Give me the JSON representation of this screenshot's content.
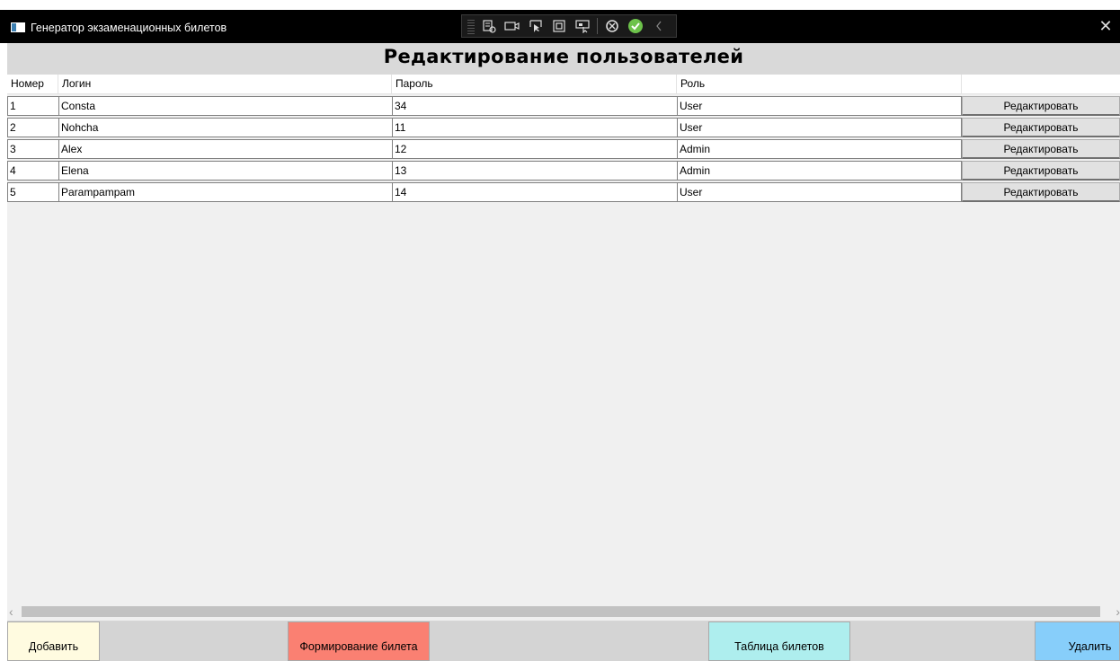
{
  "window": {
    "title": "Генератор экзаменационных билетов",
    "close_glyph": "✕"
  },
  "devtools": {
    "icons": [
      "live-visual-tree-icon",
      "video-record-icon",
      "select-element-icon",
      "display-layout-adorners-icon",
      "track-focus-icon",
      "hot-reload-icon",
      "binding-ok-icon",
      "collapse-toolbar-icon"
    ]
  },
  "page": {
    "heading": "Редактирование пользователей"
  },
  "grid": {
    "columns": [
      "Номер",
      "Логин",
      "Пароль",
      "Роль",
      ""
    ],
    "rows": [
      {
        "num": "1",
        "login": "Consta",
        "password": "34",
        "role": "User",
        "action": "Редактировать"
      },
      {
        "num": "2",
        "login": "Nohcha",
        "password": "11",
        "role": "User",
        "action": "Редактировать"
      },
      {
        "num": "3",
        "login": "Alex",
        "password": "12",
        "role": "Admin",
        "action": "Редактировать"
      },
      {
        "num": "4",
        "login": "Elena",
        "password": "13",
        "role": "Admin",
        "action": "Редактировать"
      },
      {
        "num": "5",
        "login": "Parampampam",
        "password": "14",
        "role": "User",
        "action": "Редактировать"
      }
    ]
  },
  "scrollbar": {
    "left_arrow": "‹",
    "right_arrow": "›"
  },
  "bottom_bar": {
    "add_label": "Добавить",
    "ticket_form_label": "Формирование билета",
    "ticket_table_label": "Таблица билетов",
    "delete_label": "Удалить"
  },
  "colors": {
    "add_bg": "#fffbe0",
    "ticket_form_bg": "#fa8072",
    "ticket_table_bg": "#aeeeee",
    "delete_bg": "#87cefa",
    "binding_ok": "#6dc24b"
  }
}
